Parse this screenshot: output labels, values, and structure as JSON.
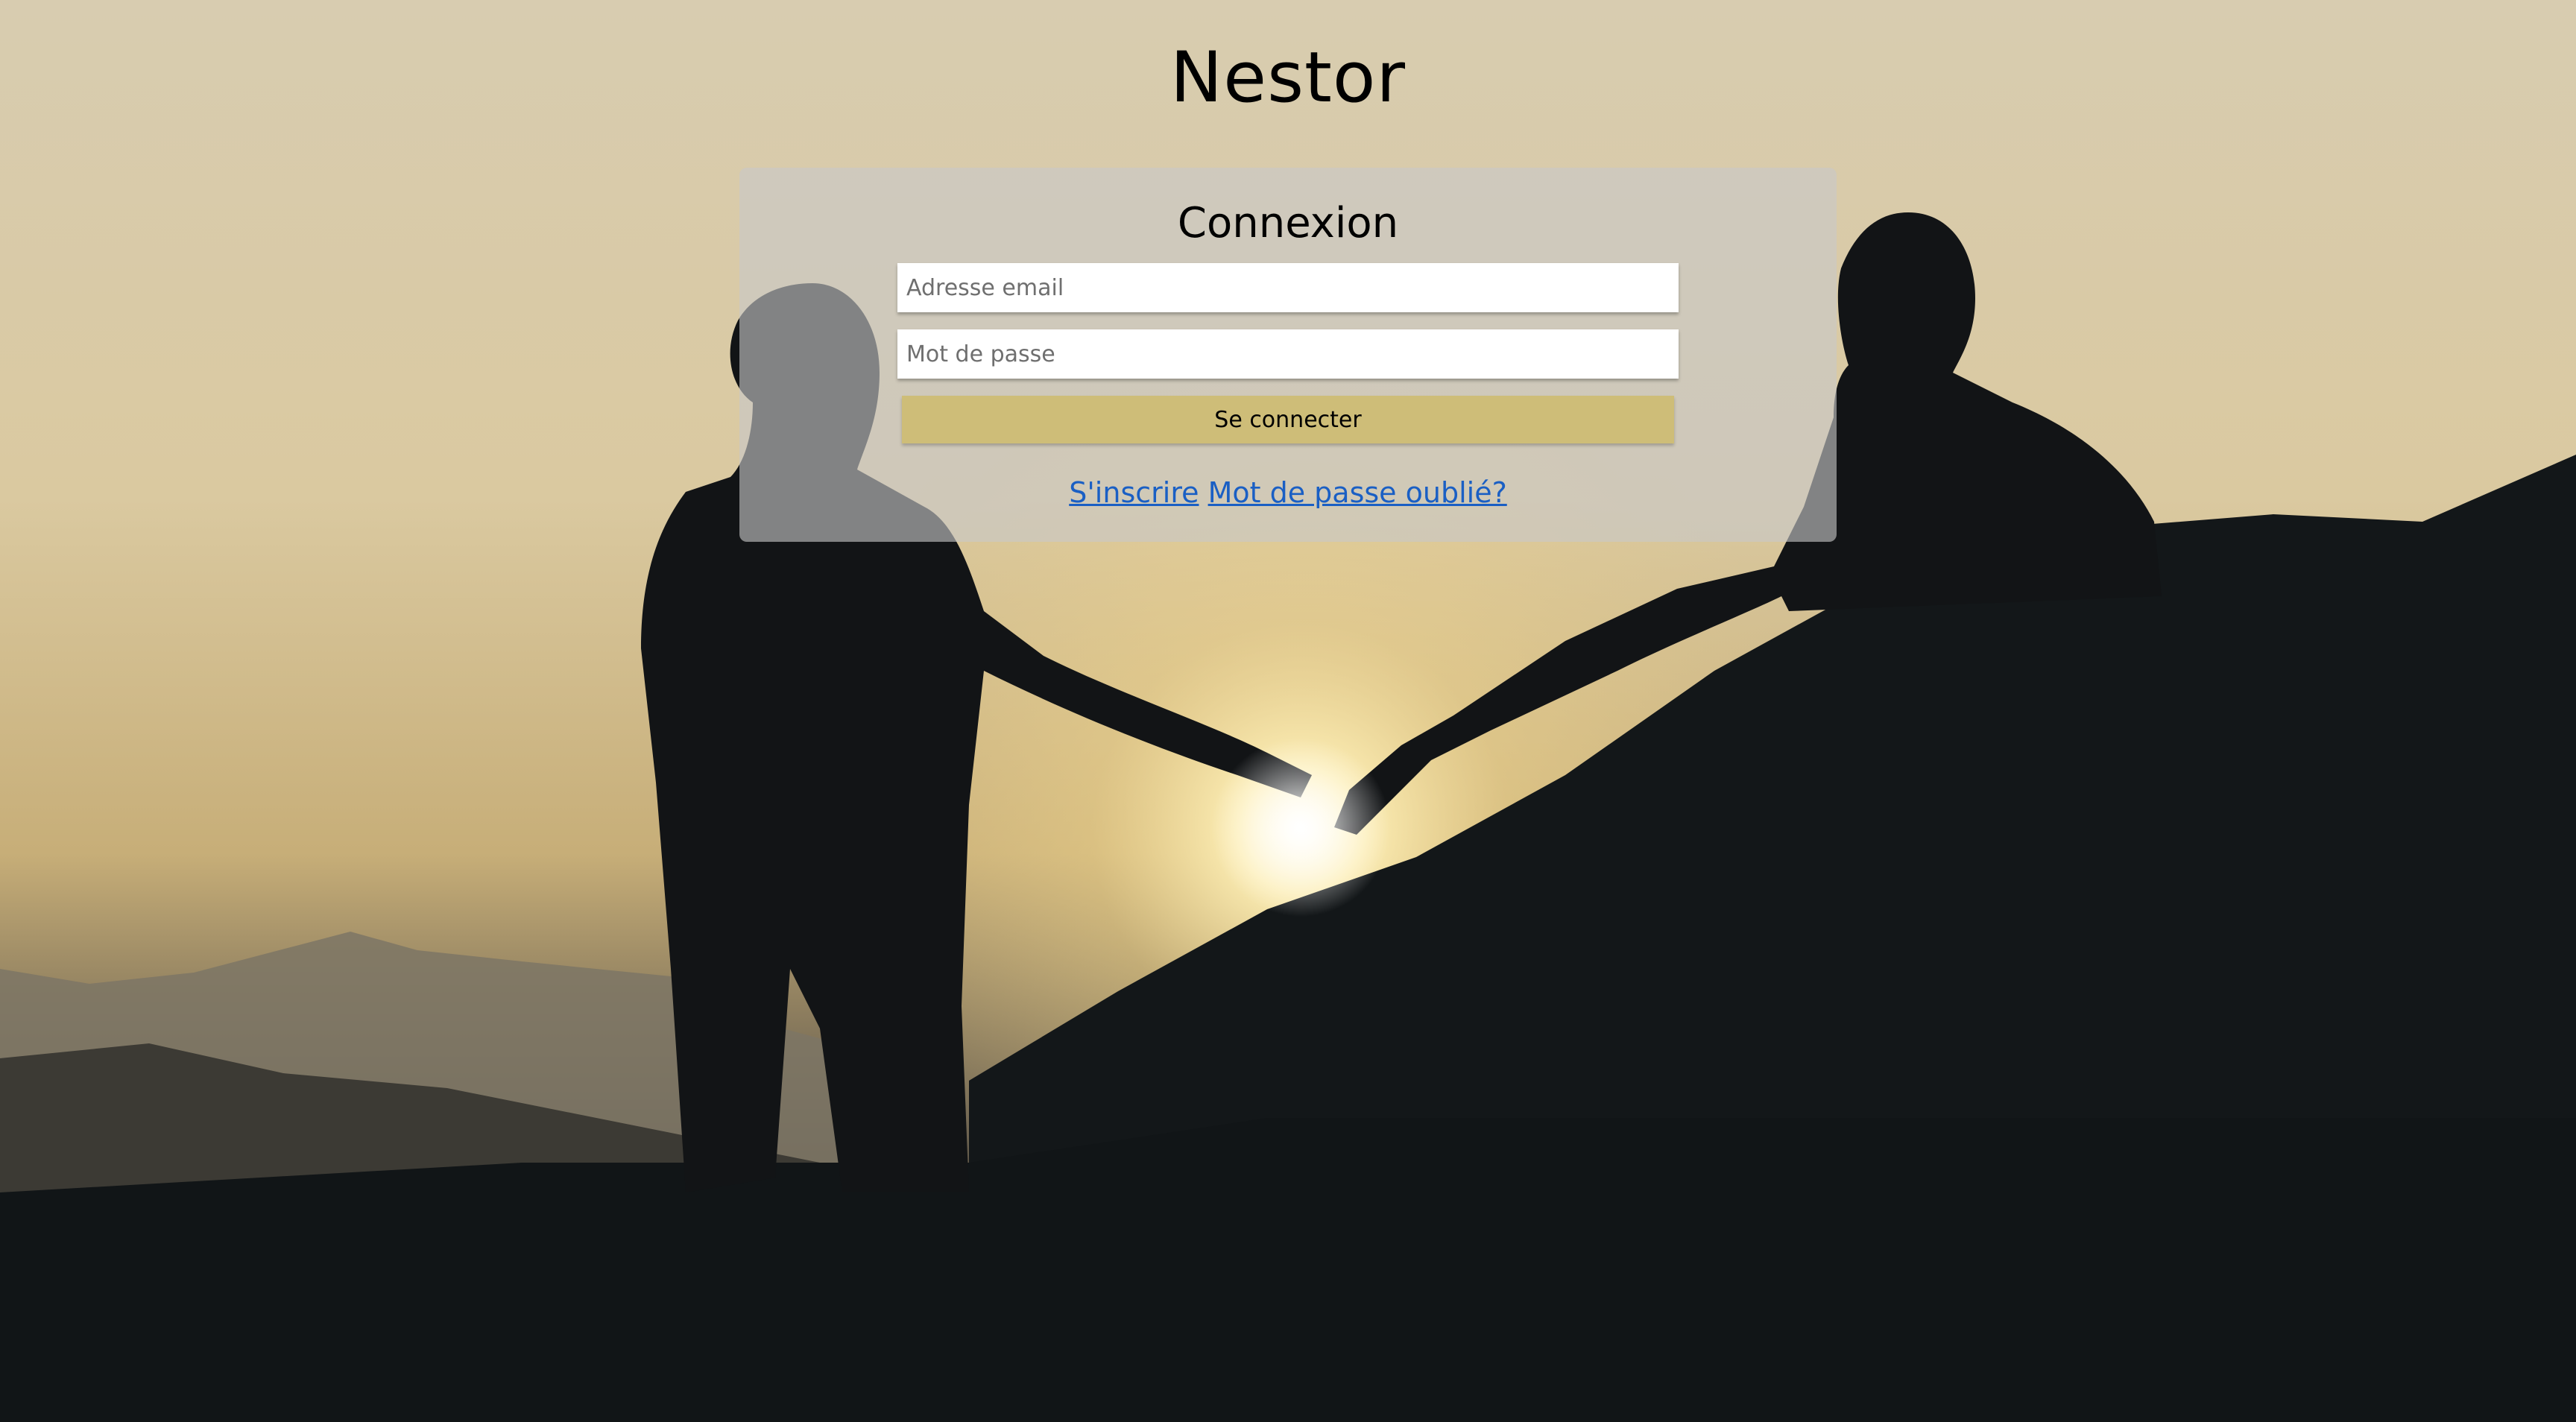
{
  "site": {
    "title": "Nestor"
  },
  "login": {
    "heading": "Connexion",
    "email_placeholder": "Adresse email",
    "email_value": "",
    "password_placeholder": "Mot de passe",
    "password_value": "",
    "submit_label": "Se connecter",
    "register_link": "S'inscrire",
    "forgot_link": "Mot de passe oublié?"
  },
  "colors": {
    "button": "#cebd78",
    "link": "#1a5fc4",
    "card": "#c8c8c8"
  }
}
